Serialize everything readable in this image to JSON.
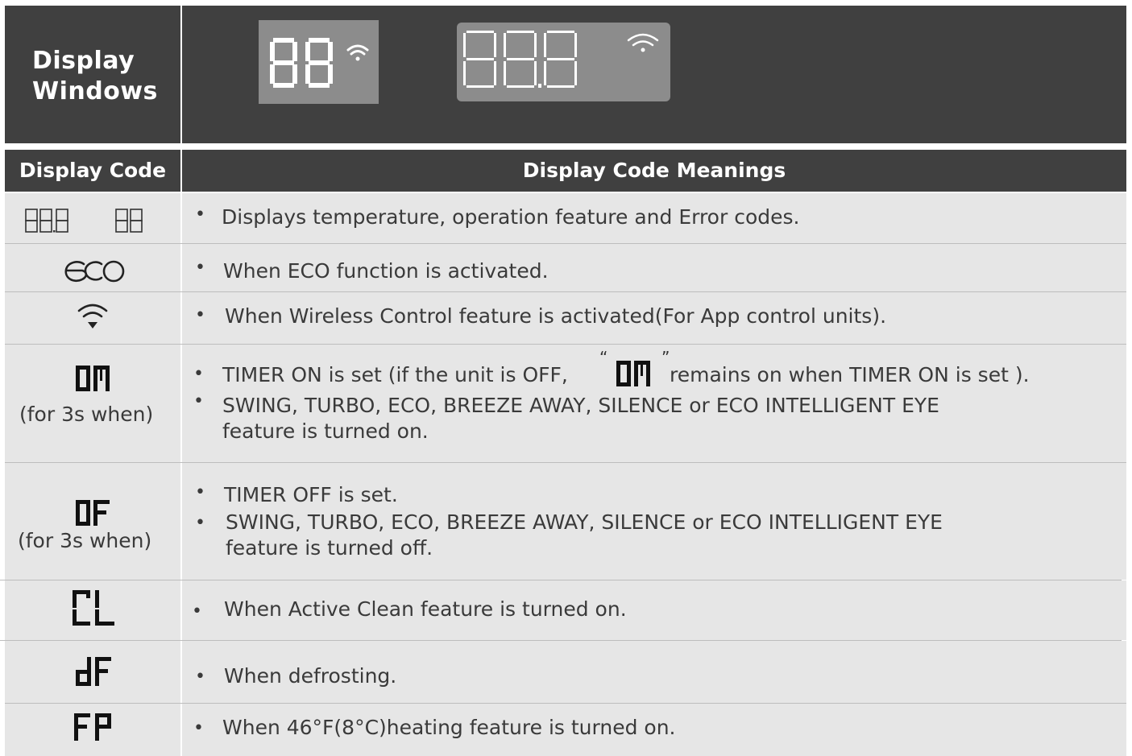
{
  "header": {
    "title_line1": "Display",
    "title_line2": "Windows"
  },
  "columns": {
    "code": "Display Code",
    "meaning": "Display Code Meanings"
  },
  "rows": [
    {
      "code_icon": "segment-888-and-88-icon",
      "meaning": "Displays  temperature, operation feature and Error codes."
    },
    {
      "code_icon": "eco-icon",
      "meaning": "When ECO function is activated."
    },
    {
      "code_icon": "wifi-icon",
      "meaning": "When Wireless Control feature is activated(For App control units)."
    },
    {
      "code_icon": "segment-on-icon",
      "code_note": "(for 3s when)",
      "meaning_1_pre": "TIMER ON is set (if the unit is OFF,",
      "meaning_1_post": "remains on when TIMER ON is set ).",
      "meaning_2_line1": "SWING, TURBO, ECO, BREEZE AWAY, SILENCE or ECO INTELLIGENT EYE",
      "meaning_2_line2": "feature is turned on."
    },
    {
      "code_icon": "segment-of-icon",
      "code_note": "(for 3s when)",
      "meaning_1": "TIMER OFF is set.",
      "meaning_2_line1": "SWING, TURBO, ECO, BREEZE AWAY, SILENCE or ECO INTELLIGENT EYE",
      "meaning_2_line2": "feature is turned off."
    },
    {
      "code_icon": "segment-cl-icon",
      "meaning": "When Active Clean feature is turned on."
    },
    {
      "code_icon": "segment-df-icon",
      "meaning": "When defrosting."
    },
    {
      "code_icon": "segment-fp-icon",
      "meaning": "When 46°F(8°C)heating feature is turned on."
    }
  ],
  "colors": {
    "header_bg": "#404040",
    "row_bg": "#e6e6e6",
    "display_bg": "#8c8c8c"
  }
}
